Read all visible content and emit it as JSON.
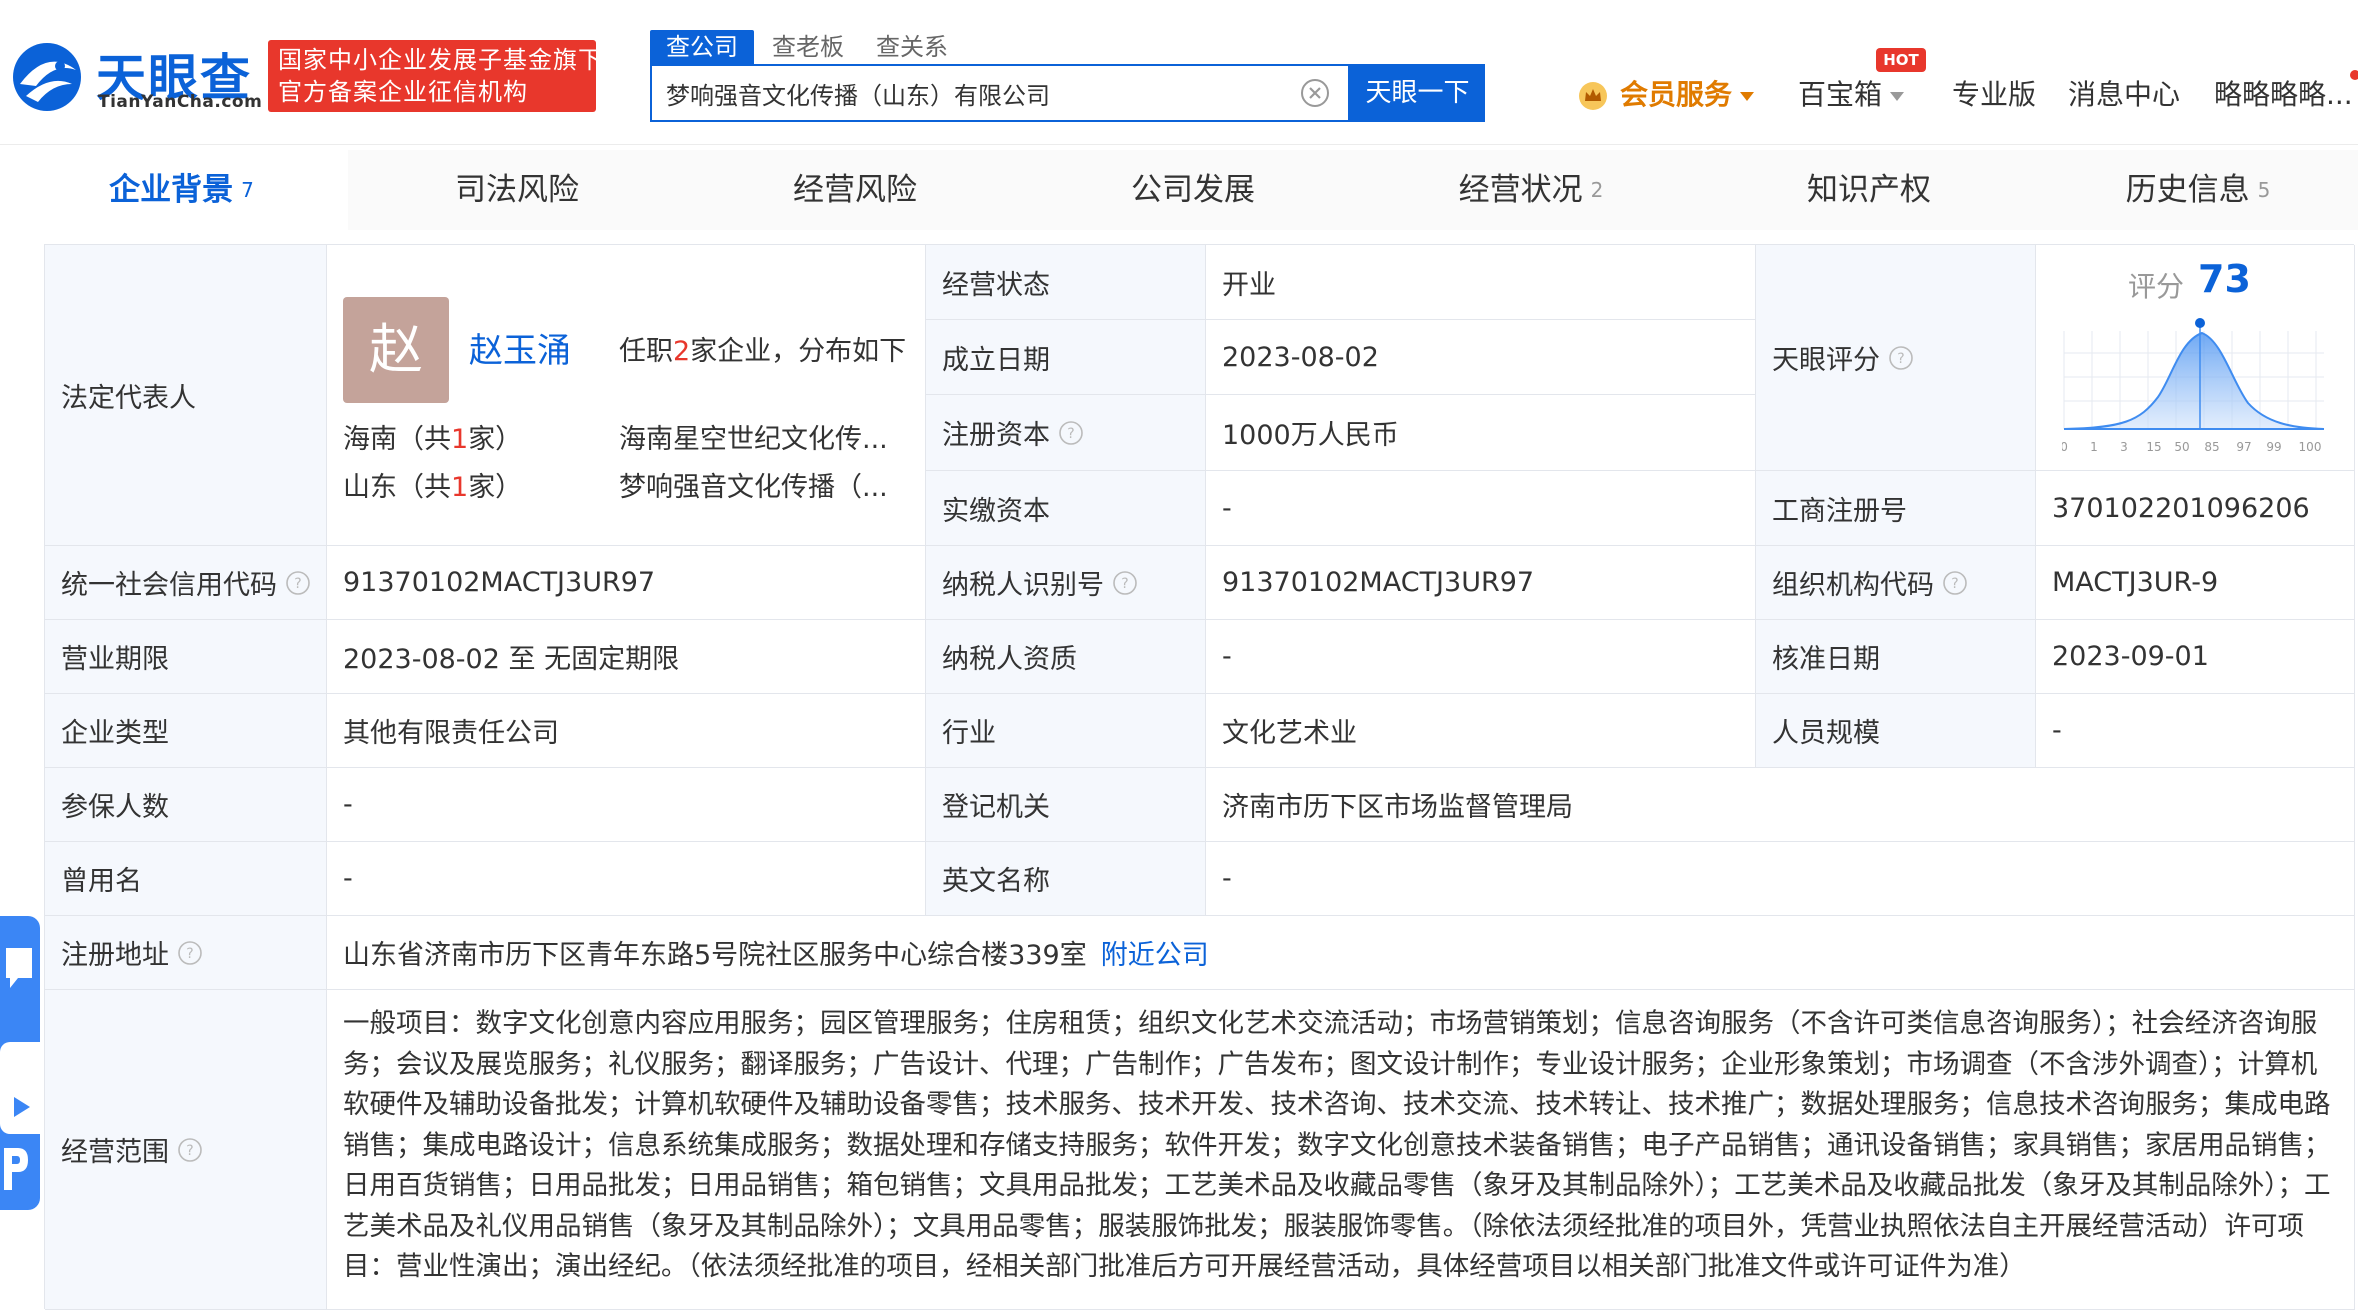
{
  "header": {
    "logo_cn": "天眼查",
    "logo_en": "TianYanCha.com",
    "badge_line1": "国家中小企业发展子基金旗下",
    "badge_line2": "官方备案企业征信机构",
    "search_tabs": [
      "查公司",
      "查老板",
      "查关系"
    ],
    "search_value": "梦响强音文化传播（山东）有限公司",
    "search_button": "天眼一下",
    "vip_label": "会员服务",
    "treasure_label": "百宝箱",
    "hot_badge": "HOT",
    "pro_label": "专业版",
    "message_label": "消息中心",
    "user_label": "略略略略..."
  },
  "tabs": [
    {
      "label": "企业背景",
      "count": "7"
    },
    {
      "label": "司法风险",
      "count": ""
    },
    {
      "label": "经营风险",
      "count": ""
    },
    {
      "label": "公司发展",
      "count": ""
    },
    {
      "label": "经营状况",
      "count": "2"
    },
    {
      "label": "知识产权",
      "count": ""
    },
    {
      "label": "历史信息",
      "count": "5"
    }
  ],
  "legal": {
    "label": "法定代表人",
    "avatar_char": "赵",
    "name": "赵玉涌",
    "note_prefix": "任职",
    "note_count": "2",
    "note_suffix": "家企业，分布如下",
    "regions": [
      {
        "region": "海南（共",
        "count": "1",
        "suffix": "家）",
        "company": "海南星空世纪文化传..."
      },
      {
        "region": "山东（共",
        "count": "1",
        "suffix": "家）",
        "company": "梦响强音文化传播（..."
      }
    ]
  },
  "info": {
    "status_label": "经营状态",
    "status_value": "开业",
    "founded_label": "成立日期",
    "founded_value": "2023-08-02",
    "capital_label": "注册资本",
    "capital_value": "1000万人民币",
    "paid_label": "实缴资本",
    "paid_value": "-",
    "score_label": "天眼评分",
    "score_caption": "评分",
    "score_value": "73",
    "score_ticks": [
      "0",
      "1",
      "3",
      "15",
      "50",
      "85",
      "97",
      "99",
      "100"
    ],
    "reg_no_label": "工商注册号",
    "reg_no_value": "370102201096206",
    "credit_label": "统一社会信用代码",
    "credit_value": "91370102MACTJ3UR97",
    "taxid_label": "纳税人识别号",
    "taxid_value": "91370102MACTJ3UR97",
    "org_label": "组织机构代码",
    "org_value": "MACTJ3UR-9",
    "term_label": "营业期限",
    "term_value": "2023-08-02 至 无固定期限",
    "taxq_label": "纳税人资质",
    "taxq_value": "-",
    "approve_label": "核准日期",
    "approve_value": "2023-09-01",
    "type_label": "企业类型",
    "type_value": "其他有限责任公司",
    "industry_label": "行业",
    "industry_value": "文化艺术业",
    "staff_label": "人员规模",
    "staff_value": "-",
    "insured_label": "参保人数",
    "insured_value": "-",
    "authority_label": "登记机关",
    "authority_value": "济南市历下区市场监督管理局",
    "former_label": "曾用名",
    "former_value": "-",
    "english_label": "英文名称",
    "english_value": "-",
    "address_label": "注册地址",
    "address_value": "山东省济南市历下区青年东路5号院社区服务中心综合楼339室",
    "nearby_link": "附近公司",
    "scope_label": "经营范围",
    "scope_value": "一般项目：数字文化创意内容应用服务；园区管理服务；住房租赁；组织文化艺术交流活动；市场营销策划；信息咨询服务（不含许可类信息咨询服务）；社会经济咨询服务；会议及展览服务；礼仪服务；翻译服务；广告设计、代理；广告制作；广告发布；图文设计制作；专业设计服务；企业形象策划；市场调查（不含涉外调查）；计算机软硬件及辅助设备批发；计算机软硬件及辅助设备零售；技术服务、技术开发、技术咨询、技术交流、技术转让、技术推广；数据处理服务；信息技术咨询服务；集成电路销售；集成电路设计；信息系统集成服务；数据处理和存储支持服务；软件开发；数字文化创意技术装备销售；电子产品销售；通讯设备销售；家具销售；家居用品销售；日用百货销售；日用品批发；日用品销售；箱包销售；文具用品批发；工艺美术品及收藏品零售（象牙及其制品除外）；工艺美术品及收藏品批发（象牙及其制品除外）；工艺美术品及礼仪用品销售（象牙及其制品除外）；文具用品零售；服装服饰批发；服装服饰零售。（除依法须经批准的项目外，凭营业执照依法自主开展经营活动）许可项目：营业性演出；演出经纪。（依法须经批准的项目，经相关部门批准后方可开展经营活动，具体经营项目以相关部门批准文件或许可证件为准）"
  },
  "colors": {
    "brand": "#0b62d8",
    "badge": "#e8372c",
    "label_bg": "#f5f8fd",
    "vip": "#e07b00"
  }
}
